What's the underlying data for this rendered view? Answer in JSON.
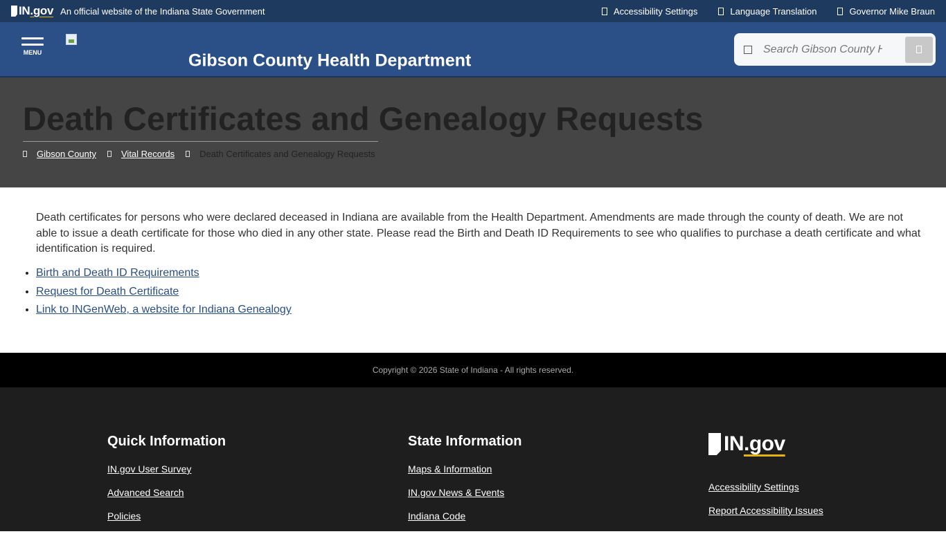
{
  "topbar": {
    "logo": {
      "prefix": "IN",
      "suffix": ".gov"
    },
    "official_text": "An official website of the Indiana State Government",
    "links": [
      {
        "label": "Accessibility Settings",
        "icon": "accessibility-icon"
      },
      {
        "label": "Language Translation",
        "icon": "translate-icon"
      },
      {
        "label": "Governor Mike Braun",
        "icon": "governor-icon"
      }
    ]
  },
  "header": {
    "menu_label": "MENU",
    "site_title": "Gibson County Health Department",
    "search": {
      "placeholder": "Search Gibson County Health Department"
    }
  },
  "hero": {
    "title": "Death Certificates and Genealogy Requests",
    "breadcrumbs": [
      {
        "label": "Gibson County",
        "link": true
      },
      {
        "label": "Vital Records",
        "link": true
      },
      {
        "label": "Death Certificates and Genealogy Requests",
        "link": false
      }
    ]
  },
  "content": {
    "intro": "Death certificates for persons who were declared deceased in Indiana are available from the Health Department. Amendments are made through the county of death. We are not able to issue a death certificate for those who died in any other state. Please read the Birth and Death ID Requirements to see who qualifies to purchase a death certificate and what identification is required.",
    "links": [
      "Birth and Death ID Requirements",
      "Request for Death Certificate",
      "Link to INGenWeb, a website for Indiana Genealogy"
    ]
  },
  "copyright": "Copyright © 2026 State of Indiana - All rights reserved.",
  "footer": {
    "quick_information": {
      "heading": "Quick Information",
      "links": [
        "IN.gov User Survey",
        "Advanced Search",
        "Policies"
      ]
    },
    "state_information": {
      "heading": "State Information",
      "links": [
        "Maps & Information",
        "IN.gov News & Events",
        "Indiana Code"
      ]
    },
    "ingov": {
      "logo": {
        "prefix": "IN",
        "suffix": ".gov"
      },
      "links": [
        "Accessibility Settings",
        "Report Accessibility Issues"
      ]
    }
  },
  "colors": {
    "topbar_bg": "#1f3a5f",
    "header_bg": "#2b4f87",
    "hero_bg": "#454545",
    "link": "#2b4f87",
    "footer_bg": "#1e1e1e",
    "gov_accent": "#e8b30e"
  }
}
